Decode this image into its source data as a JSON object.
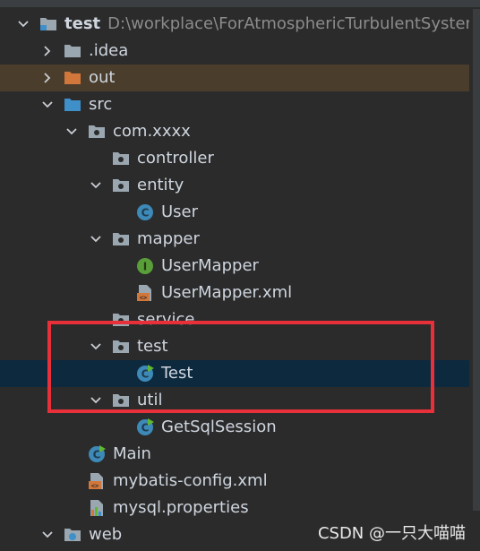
{
  "project": {
    "name": "test",
    "path": "D:\\workplace\\ForAtmosphericTurbulentSystem\\"
  },
  "tree": [
    {
      "label": "test",
      "indent": 0,
      "expanded": true,
      "icon": "module-folder-icon",
      "bold": true,
      "path_key": true
    },
    {
      "label": ".idea",
      "indent": 1,
      "expanded": false,
      "icon": "folder-icon"
    },
    {
      "label": "out",
      "indent": 1,
      "expanded": false,
      "icon": "excluded-folder-icon",
      "highlight": "out"
    },
    {
      "label": "src",
      "indent": 1,
      "expanded": true,
      "icon": "source-folder-icon"
    },
    {
      "label": "com.xxxx",
      "indent": 2,
      "expanded": true,
      "icon": "package-icon"
    },
    {
      "label": "controller",
      "indent": 3,
      "expanded": null,
      "icon": "package-icon"
    },
    {
      "label": "entity",
      "indent": 3,
      "expanded": true,
      "icon": "package-icon"
    },
    {
      "label": "User",
      "indent": 4,
      "expanded": null,
      "icon": "class-icon"
    },
    {
      "label": "mapper",
      "indent": 3,
      "expanded": true,
      "icon": "package-icon"
    },
    {
      "label": "UserMapper",
      "indent": 4,
      "expanded": null,
      "icon": "interface-icon"
    },
    {
      "label": "UserMapper.xml",
      "indent": 4,
      "expanded": null,
      "icon": "xml-file-icon"
    },
    {
      "label": "service",
      "indent": 3,
      "expanded": null,
      "icon": "package-icon"
    },
    {
      "label": "test",
      "indent": 3,
      "expanded": true,
      "icon": "package-icon"
    },
    {
      "label": "Test",
      "indent": 4,
      "expanded": null,
      "icon": "runnable-class-icon",
      "selected": true
    },
    {
      "label": "util",
      "indent": 3,
      "expanded": true,
      "icon": "package-icon"
    },
    {
      "label": "GetSqlSession",
      "indent": 4,
      "expanded": null,
      "icon": "runnable-class-icon"
    },
    {
      "label": "Main",
      "indent": 2,
      "expanded": null,
      "icon": "runnable-class-icon"
    },
    {
      "label": "mybatis-config.xml",
      "indent": 2,
      "expanded": null,
      "icon": "xml-file-icon"
    },
    {
      "label": "mysql.properties",
      "indent": 2,
      "expanded": null,
      "icon": "properties-file-icon"
    },
    {
      "label": "web",
      "indent": 1,
      "expanded": true,
      "icon": "web-folder-icon"
    }
  ],
  "watermark": "CSDN @一只大喵喵",
  "colors": {
    "background": "#2b2b2b",
    "selected_row": "#0d293e",
    "excluded_row": "#4a3d2c",
    "annotation_box": "#e8303a",
    "folder_grey": "#9aa7b0",
    "folder_orange": "#d2773b",
    "folder_blue": "#3f8fc9",
    "class_blue": "#3d89b8",
    "interface_green": "#5a9e3a"
  }
}
